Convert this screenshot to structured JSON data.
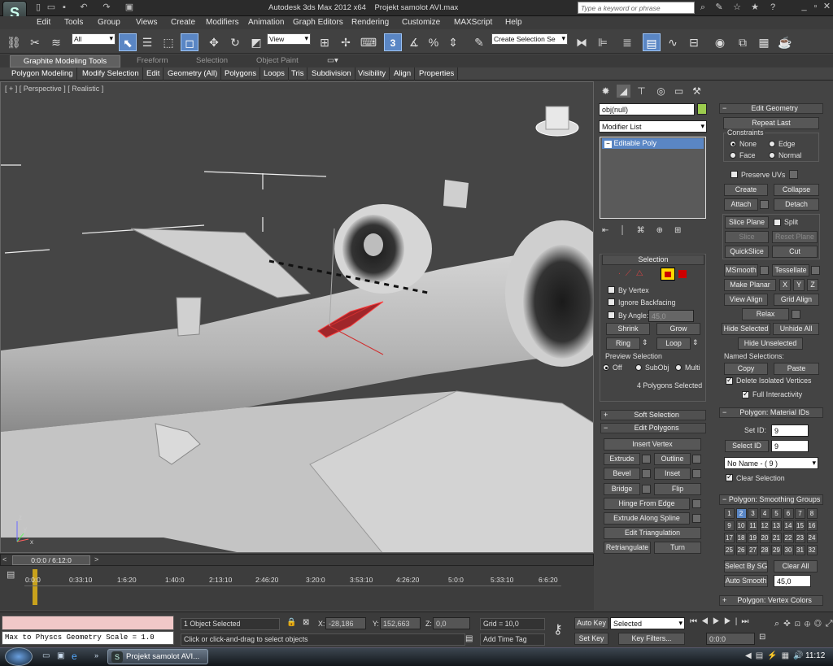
{
  "title": {
    "app": "Autodesk 3ds Max  2012 x64",
    "file": "Projekt samolot AVI.max",
    "search_placeholder": "Type a keyword or phrase"
  },
  "menu": [
    "Edit",
    "Tools",
    "Group",
    "Views",
    "Create",
    "Modifiers",
    "Animation",
    "Graph Editors",
    "Rendering",
    "Customize",
    "MAXScript",
    "Help"
  ],
  "toolbar": {
    "selection_filter": "All",
    "coord_system": "View",
    "named_selection": "Create Selection Se",
    "snap_label": "3"
  },
  "ribbon": {
    "tabs": [
      "Graphite Modeling Tools",
      "Freeform",
      "Selection",
      "Object Paint"
    ],
    "items": [
      "Polygon Modeling",
      "Modify Selection",
      "Edit",
      "Geometry (All)",
      "Polygons",
      "Loops",
      "Tris",
      "Subdivision",
      "Visibility",
      "Align",
      "Properties"
    ]
  },
  "viewport": {
    "label": "[ + ] [ Perspective ] [ Realistic ]",
    "gizmo": {
      "x": "x",
      "y": "y",
      "z": "z"
    }
  },
  "command_panel": {
    "object_name": "obj(null)",
    "modifier_list": "Modifier List",
    "stack": [
      "Editable Poly"
    ],
    "selection": {
      "header": "Selection",
      "by_vertex": "By Vertex",
      "ignore_backfacing": "Ignore Backfacing",
      "by_angle": "By Angle:",
      "angle_value": "45,0",
      "shrink": "Shrink",
      "grow": "Grow",
      "ring": "Ring",
      "loop": "Loop",
      "preview_title": "Preview Selection",
      "preview_off": "Off",
      "preview_subobj": "SubObj",
      "preview_multi": "Multi",
      "status": "4 Polygons Selected"
    },
    "soft_selection": "Soft Selection",
    "edit_polygons": {
      "header": "Edit Polygons",
      "insert_vertex": "Insert Vertex",
      "extrude": "Extrude",
      "outline": "Outline",
      "bevel": "Bevel",
      "inset": "Inset",
      "bridge": "Bridge",
      "flip": "Flip",
      "hinge": "Hinge From Edge",
      "extrude_spline": "Extrude Along Spline",
      "edit_triangulation": "Edit Triangulation",
      "retriangulate": "Retriangulate",
      "turn": "Turn"
    },
    "edit_geometry": {
      "header": "Edit Geometry",
      "repeat_last": "Repeat Last",
      "constraints": "Constraints",
      "none": "None",
      "edge": "Edge",
      "face": "Face",
      "normal": "Normal",
      "preserve_uvs": "Preserve UVs",
      "create": "Create",
      "collapse": "Collapse",
      "attach": "Attach",
      "detach": "Detach",
      "slice_plane": "Slice Plane",
      "split": "Split",
      "slice": "Slice",
      "reset_plane": "Reset Plane",
      "quickslice": "QuickSlice",
      "cut": "Cut",
      "msmooth": "MSmooth",
      "tessellate": "Tessellate",
      "make_planar": "Make Planar",
      "x": "X",
      "y": "Y",
      "z": "Z",
      "view_align": "View Align",
      "grid_align": "Grid Align",
      "relax": "Relax",
      "hide_selected": "Hide Selected",
      "unhide_all": "Unhide All",
      "hide_unselected": "Hide Unselected",
      "named_selections": "Named Selections:",
      "copy": "Copy",
      "paste": "Paste",
      "delete_isolated": "Delete Isolated Vertices",
      "full_interactivity": "Full Interactivity"
    },
    "material_ids": {
      "header": "Polygon: Material IDs",
      "set_id": "Set ID:",
      "set_id_value": "9",
      "select_id": "Select ID",
      "select_id_value": "9",
      "name_drop": "No Name - ( 9 )",
      "clear_selection": "Clear Selection"
    },
    "smoothing": {
      "header": "Polygon: Smoothing Groups",
      "groups": [
        "1",
        "2",
        "3",
        "4",
        "5",
        "6",
        "7",
        "8",
        "9",
        "10",
        "11",
        "12",
        "13",
        "14",
        "15",
        "16",
        "17",
        "18",
        "19",
        "20",
        "21",
        "22",
        "23",
        "24",
        "25",
        "26",
        "27",
        "28",
        "29",
        "30",
        "31",
        "32"
      ],
      "active": "2",
      "select_by_sg": "Select By SG",
      "clear_all": "Clear All",
      "auto_smooth": "Auto Smooth",
      "auto_value": "45,0"
    },
    "vertex_colors": "Polygon: Vertex Colors"
  },
  "timeline": {
    "slider": "0:0:0 / 6:12:0",
    "ticks": [
      "0:0:0",
      "0:33:10",
      "1:6:20",
      "1:40:0",
      "2:13:10",
      "2:46:20",
      "3:20:0",
      "3:53:10",
      "4:26:20",
      "5:0:0",
      "5:33:10",
      "6:6:20"
    ]
  },
  "status": {
    "maxscript": "Max to Physcs Geometry Scale = 1.0",
    "objects": "1 Object Selected",
    "prompt": "Click or click-and-drag to select objects",
    "x_label": "X:",
    "x": "-28,186",
    "y_label": "Y:",
    "y": "152,663",
    "z_label": "Z:",
    "z": "0,0",
    "grid": "Grid = 10,0",
    "add_time_tag": "Add Time Tag",
    "auto_key": "Auto Key",
    "set_key": "Set Key",
    "selected": "Selected",
    "key_filters": "Key Filters...",
    "frame": "0:0:0"
  },
  "taskbar": {
    "task": "Projekt samolot AVI...",
    "clock": "11:12"
  }
}
